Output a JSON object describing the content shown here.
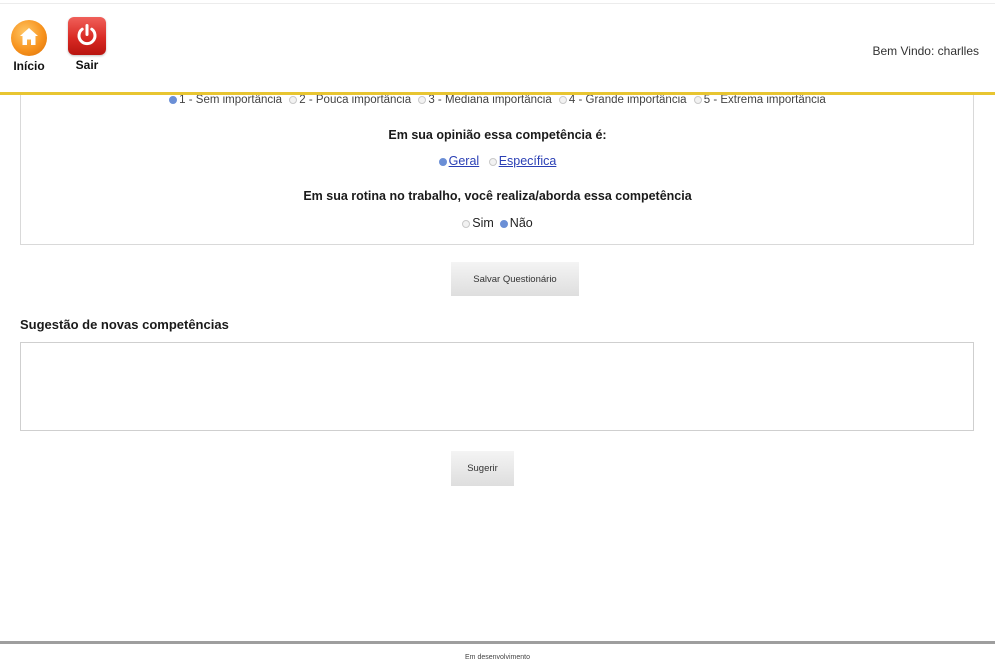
{
  "header": {
    "home_label": "Início",
    "exit_label": "Sair",
    "welcome_text": "Bem Vindo: charlles",
    "home_icon": "home-icon",
    "exit_icon": "power-icon",
    "accent_color": "#e8c531"
  },
  "question": {
    "scale_options": [
      {
        "label": "1 - Sem importância",
        "checked": true
      },
      {
        "label": "2 - Pouca importância",
        "checked": false
      },
      {
        "label": "3 - Mediana importância",
        "checked": false
      },
      {
        "label": "4 - Grande importância",
        "checked": false
      },
      {
        "label": "5 - Extrema importância",
        "checked": false
      }
    ],
    "opinion_title": "Em sua opinião essa competência é:",
    "opinion_options": [
      {
        "label": "Geral",
        "checked": true
      },
      {
        "label": "Específica",
        "checked": false
      }
    ],
    "routine_title": "Em sua rotina no trabalho, você realiza/aborda essa competência",
    "routine_options": [
      {
        "label": "Sim",
        "checked": false
      },
      {
        "label": "Não",
        "checked": true
      }
    ]
  },
  "actions": {
    "save_label": "Salvar Questionário",
    "suggest_label": "Sugerir"
  },
  "suggestion": {
    "title": "Sugestão de novas competências",
    "value": ""
  },
  "footer": {
    "text": "Em desenvolvimento"
  }
}
